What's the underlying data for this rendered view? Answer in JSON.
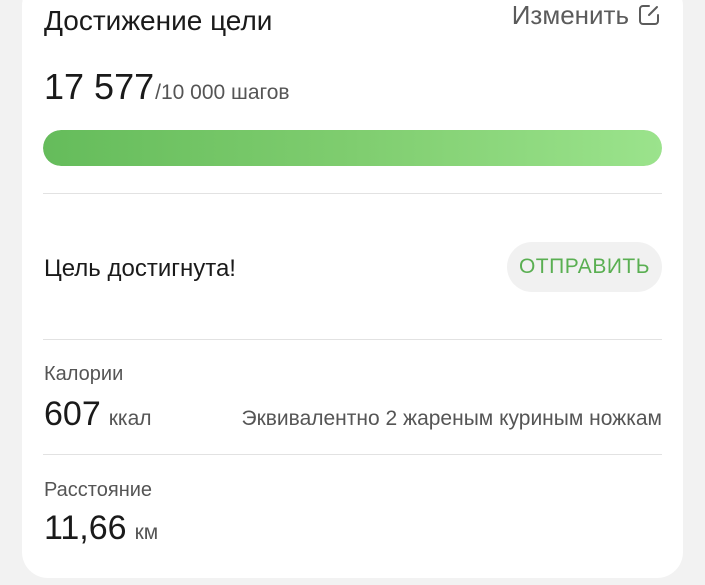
{
  "goal": {
    "title": "Достижение цели",
    "edit_label": "Изменить",
    "steps_value": "17 577",
    "steps_target": "/10 000 шагов",
    "progress_fraction": 1.0,
    "status_text": "Цель достигнута!",
    "send_label": "ОТПРАВИТЬ"
  },
  "calories": {
    "label": "Калории",
    "value": "607",
    "unit": "ккал",
    "equivalent": "Эквивалентно 2 жареным куриным ножкам"
  },
  "distance": {
    "label": "Расстояние",
    "value": "11,66",
    "unit": "км"
  },
  "colors": {
    "accent": "#5aaf52",
    "progress_start": "#65bc5b",
    "progress_end": "#9be38c"
  },
  "icons": {
    "edit": "edit-icon"
  }
}
